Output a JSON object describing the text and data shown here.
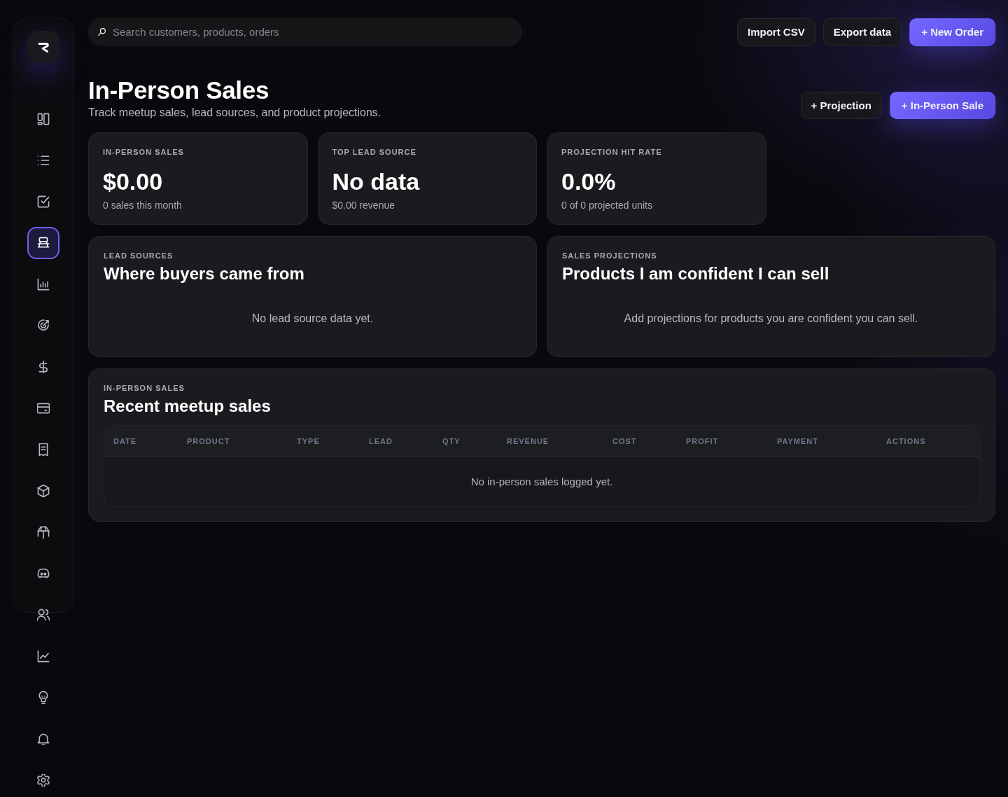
{
  "sidebar": {
    "items": [
      {
        "selected": false
      },
      {
        "selected": false
      },
      {
        "selected": false
      },
      {
        "selected": true
      },
      {
        "selected": false
      },
      {
        "selected": false
      },
      {
        "selected": false
      },
      {
        "selected": false
      },
      {
        "selected": false
      },
      {
        "selected": false
      },
      {
        "selected": false
      },
      {
        "selected": false
      },
      {
        "selected": false
      },
      {
        "selected": false
      },
      {
        "selected": false
      },
      {
        "selected": false
      },
      {
        "selected": false
      }
    ]
  },
  "search": {
    "placeholder": "Search customers, products, orders"
  },
  "top_actions": [
    {
      "label": "Import CSV",
      "kind": "secondary"
    },
    {
      "label": "Export data",
      "kind": "secondary"
    },
    {
      "label": "+ New Order",
      "kind": "primary"
    }
  ],
  "header": {
    "title": "In-Person Sales",
    "subtitle": "Track meetup sales, lead sources, and product projections.",
    "actions": [
      {
        "label": "+ Projection",
        "kind": "secondary"
      },
      {
        "label": "+ In-Person Sale",
        "kind": "primary"
      }
    ]
  },
  "stats": [
    {
      "label": "IN-PERSON SALES",
      "value": "$0.00",
      "caption": "0 sales this month"
    },
    {
      "label": "TOP LEAD SOURCE",
      "value": "No data",
      "caption": "$0.00 revenue"
    },
    {
      "label": "PROJECTION HIT RATE",
      "value": "0.0%",
      "caption": "0 of 0 projected units"
    }
  ],
  "panels": [
    {
      "eyebrow": "LEAD SOURCES",
      "title": "Where buyers came from",
      "empty_message": "No lead source data yet."
    },
    {
      "eyebrow": "SALES PROJECTIONS",
      "title": "Products I am confident I can sell",
      "empty_message": "Add projections for products you are confident you can sell."
    }
  ],
  "recent_sales": {
    "eyebrow": "IN-PERSON SALES",
    "title": "Recent meetup sales",
    "table": {
      "columns": [
        "DATE",
        "PRODUCT",
        "TYPE",
        "LEAD",
        "QTY",
        "REVENUE",
        "COST",
        "PROFIT",
        "PAYMENT",
        "ACTIONS"
      ],
      "empty_message": "No in-person sales logged yet."
    }
  }
}
